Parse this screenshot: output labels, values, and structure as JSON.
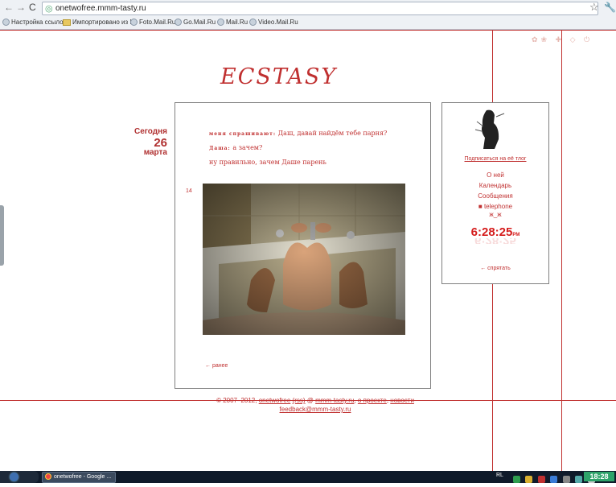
{
  "browser": {
    "url": "onetwofree.mmm-tasty.ru",
    "bookmarks": [
      "Настройка ссылок",
      "Импортировано из IE",
      "Foto.Mail.Ru",
      "Go.Mail.Ru",
      "Mail.Ru",
      "Video.Mail.Ru"
    ]
  },
  "blog": {
    "title": "ECSTASY",
    "date": {
      "today": "Сегодня",
      "day": "26",
      "month": "марта"
    },
    "post": {
      "lines": [
        {
          "speaker": "меня спрашивают:",
          "text": "Даш, давай найдём тебе парня?"
        },
        {
          "speaker": "Даша:",
          "text": "а зачем?"
        },
        {
          "speaker": "",
          "text": "ну правильно, зачем Даше парень"
        }
      ],
      "number": "14",
      "earlier_link": "← ранее"
    },
    "sidebar": {
      "subscribe": "Подписаться на её тлог",
      "links": [
        "О ней",
        "Календарь",
        "Сообщения",
        "telephone"
      ],
      "emoticon": "ж_ж",
      "clock": {
        "time": "6:28:25",
        "ampm": "PM"
      },
      "hide_link": "← спрятать"
    },
    "footer": {
      "copyright": "© 2007–2012,",
      "author": "onetwofree",
      "rss": "(rss)",
      "site_prefix": "@",
      "site": "mmm-tasty.ru",
      "about": "о проекте",
      "news": "новости",
      "email": "feedback@mmm-tasty.ru"
    }
  },
  "taskbar": {
    "active_window": "onetwofree - Google ...",
    "language": "RL",
    "time": "18:28"
  },
  "colors": {
    "accent": "#c03030",
    "border": "#7f7f7f",
    "clock": "#d51c1c"
  }
}
